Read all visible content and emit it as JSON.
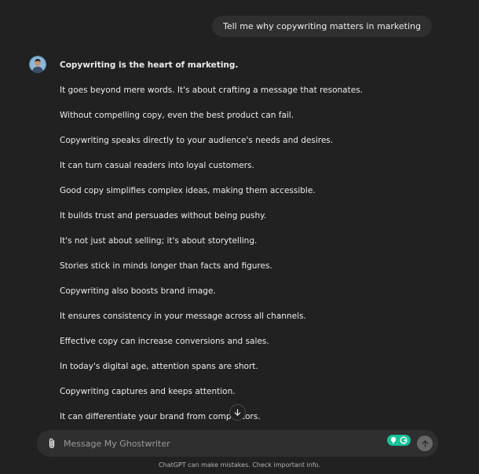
{
  "conversation": {
    "user_message": "Tell me why copywriting matters in marketing",
    "assistant_lines": [
      "Copywriting is the heart of marketing.",
      "It goes beyond mere words. It's about crafting a message that resonates.",
      "Without compelling copy, even the best product can fail.",
      "Copywriting speaks directly to your audience's needs and desires.",
      "It can turn casual readers into loyal customers.",
      "Good copy simplifies complex ideas, making them accessible.",
      "It builds trust and persuades without being pushy.",
      "It's not just about selling; it's about storytelling.",
      "Stories stick in minds longer than facts and figures.",
      "Copywriting also boosts brand image.",
      "It ensures consistency in your message across all channels.",
      "Effective copy can increase conversions and sales.",
      "In today's digital age, attention spans are short.",
      "Copywriting captures and keeps attention.",
      "It can differentiate your brand from competitors."
    ]
  },
  "composer": {
    "placeholder": "Message My Ghostwriter",
    "value": ""
  },
  "footer": {
    "disclaimer": "ChatGPT can make mistakes. Check important info."
  },
  "icons": {
    "attach": "paperclip-icon",
    "scroll": "arrow-down-icon",
    "send": "arrow-up-icon",
    "extension": "grammarly-icon"
  },
  "colors": {
    "background": "#212121",
    "bubble": "#2f2f2f",
    "text": "#ececec",
    "extension_green": "#15c39a",
    "send_disabled": "#676767"
  }
}
